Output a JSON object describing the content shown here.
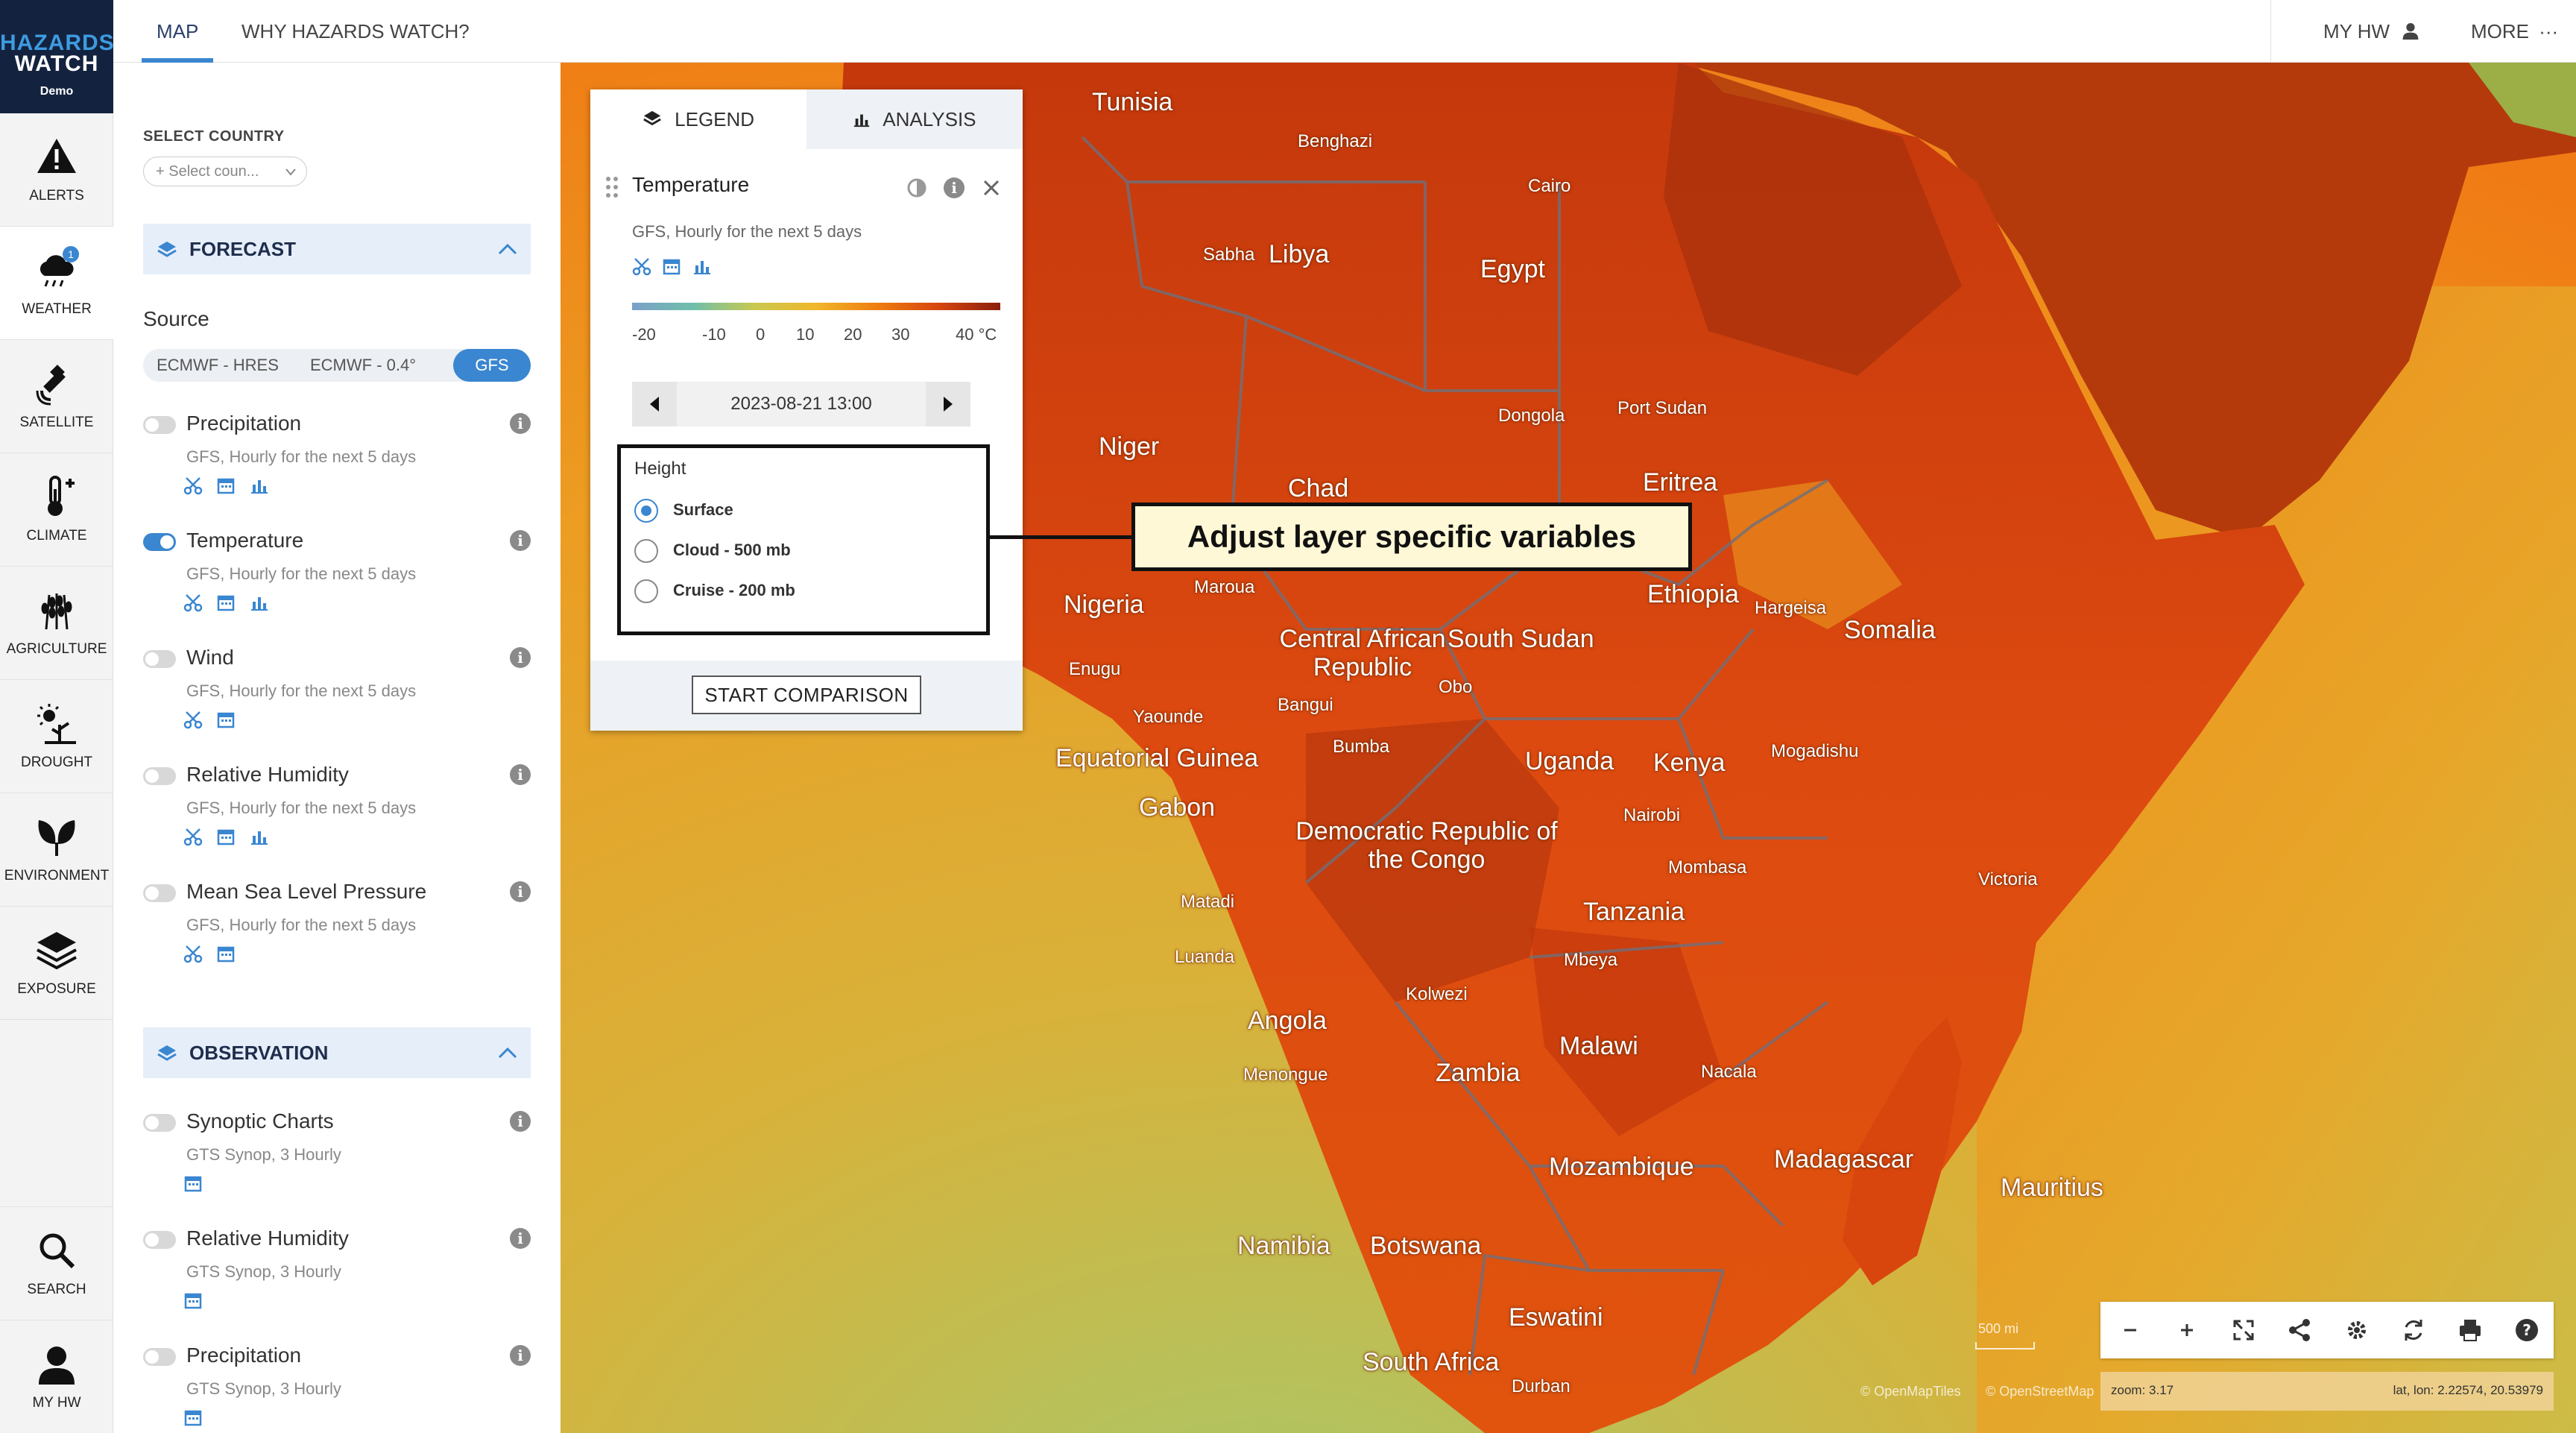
{
  "logo": {
    "line1": "HAZARDS",
    "line2": "WATCH",
    "badge": "Demo"
  },
  "rail": [
    {
      "label": "ALERTS",
      "icon": "warning-icon"
    },
    {
      "label": "WEATHER",
      "icon": "cloud-rain-icon",
      "active": true,
      "badge": "1"
    },
    {
      "label": "SATELLITE",
      "icon": "satellite-icon"
    },
    {
      "label": "CLIMATE",
      "icon": "thermometer-icon"
    },
    {
      "label": "AGRICULTURE",
      "icon": "wheat-icon"
    },
    {
      "label": "DROUGHT",
      "icon": "sun-drought-icon"
    },
    {
      "label": "ENVIRONMENT",
      "icon": "leaf-icon"
    },
    {
      "label": "EXPOSURE",
      "icon": "layers-icon"
    }
  ],
  "rail_bottom": [
    {
      "label": "SEARCH",
      "icon": "search-icon"
    },
    {
      "label": "MY HW",
      "icon": "user-icon"
    }
  ],
  "topbar": {
    "tabs": [
      "MAP",
      "WHY HAZARDS WATCH?"
    ],
    "my_hw": "MY HW",
    "more": "MORE"
  },
  "panel": {
    "select_country_label": "SELECT COUNTRY",
    "select_country_placeholder": "+ Select coun...",
    "forecast": {
      "title": "FORECAST",
      "source_label": "Source",
      "sources": [
        "ECMWF - HRES",
        "ECMWF - 0.4°",
        "GFS"
      ],
      "selected_source": "GFS",
      "layers": [
        {
          "name": "Precipitation",
          "desc": "GFS, Hourly for the next 5 days",
          "on": false,
          "tools": [
            "scissors-icon",
            "calendar-icon",
            "bar-chart-icon"
          ]
        },
        {
          "name": "Temperature",
          "desc": "GFS, Hourly for the next 5 days",
          "on": true,
          "tools": [
            "scissors-icon",
            "calendar-icon",
            "bar-chart-icon"
          ]
        },
        {
          "name": "Wind",
          "desc": "GFS, Hourly for the next 5 days",
          "on": false,
          "tools": [
            "scissors-icon",
            "calendar-icon"
          ]
        },
        {
          "name": "Relative Humidity",
          "desc": "GFS, Hourly for the next 5 days",
          "on": false,
          "tools": [
            "scissors-icon",
            "calendar-icon",
            "bar-chart-icon"
          ]
        },
        {
          "name": "Mean Sea Level Pressure",
          "desc": "GFS, Hourly for the next 5 days",
          "on": false,
          "tools": [
            "scissors-icon",
            "calendar-icon"
          ]
        }
      ]
    },
    "observation": {
      "title": "OBSERVATION",
      "layers": [
        {
          "name": "Synoptic Charts",
          "desc": "GTS Synop, 3 Hourly",
          "on": false,
          "tools": [
            "calendar-icon"
          ]
        },
        {
          "name": "Relative Humidity",
          "desc": "GTS Synop, 3 Hourly",
          "on": false,
          "tools": [
            "calendar-icon"
          ]
        },
        {
          "name": "Precipitation",
          "desc": "GTS Synop, 3 Hourly",
          "on": false,
          "tools": [
            "calendar-icon"
          ]
        }
      ]
    }
  },
  "legend": {
    "tabs": [
      "LEGEND",
      "ANALYSIS"
    ],
    "layer_title": "Temperature",
    "layer_desc": "GFS, Hourly for the next 5 days",
    "colorbar_labels": [
      "-20",
      "-10",
      "0",
      "10",
      "20",
      "30",
      "40 °C"
    ],
    "datetime": "2023-08-21 13:00",
    "height_label": "Height",
    "height_options": [
      "Surface",
      "Cloud - 500 mb",
      "Cruise - 200 mb"
    ],
    "height_selected": "Surface",
    "compare_button": "START COMPARISON"
  },
  "callout": "Adjust layer specific variables",
  "map": {
    "places": [
      {
        "name": "Tunisia",
        "kind": "country"
      },
      {
        "name": "Benghazi",
        "kind": "town"
      },
      {
        "name": "Cairo",
        "kind": "town"
      },
      {
        "name": "Sabha",
        "kind": "town"
      },
      {
        "name": "Libya",
        "kind": "country"
      },
      {
        "name": "Egypt",
        "kind": "country"
      },
      {
        "name": "Niger",
        "kind": "country"
      },
      {
        "name": "Dongola",
        "kind": "town"
      },
      {
        "name": "Port Sudan",
        "kind": "town"
      },
      {
        "name": "Chad",
        "kind": "country"
      },
      {
        "name": "Eritrea",
        "kind": "country"
      },
      {
        "name": "Nigeria",
        "kind": "country"
      },
      {
        "name": "Maroua",
        "kind": "town"
      },
      {
        "name": "Ethiopia",
        "kind": "country"
      },
      {
        "name": "Hargeisa",
        "kind": "town"
      },
      {
        "name": "Somalia",
        "kind": "country"
      },
      {
        "name": "Central African Republic",
        "kind": "country"
      },
      {
        "name": "South Sudan",
        "kind": "country"
      },
      {
        "name": "Enugu",
        "kind": "town"
      },
      {
        "name": "Obo",
        "kind": "town"
      },
      {
        "name": "Bangui",
        "kind": "town"
      },
      {
        "name": "Yaounde",
        "kind": "town"
      },
      {
        "name": "Equatorial Guinea",
        "kind": "country"
      },
      {
        "name": "Bumba",
        "kind": "town"
      },
      {
        "name": "Uganda",
        "kind": "country"
      },
      {
        "name": "Kenya",
        "kind": "country"
      },
      {
        "name": "Mogadishu",
        "kind": "town"
      },
      {
        "name": "Gabon",
        "kind": "country"
      },
      {
        "name": "Nairobi",
        "kind": "town"
      },
      {
        "name": "Democratic Republic of the Congo",
        "kind": "country"
      },
      {
        "name": "Mombasa",
        "kind": "town"
      },
      {
        "name": "Victoria",
        "kind": "town"
      },
      {
        "name": "Matadi",
        "kind": "town"
      },
      {
        "name": "Tanzania",
        "kind": "country"
      },
      {
        "name": "Luanda",
        "kind": "town"
      },
      {
        "name": "Mbeya",
        "kind": "town"
      },
      {
        "name": "Kolwezi",
        "kind": "town"
      },
      {
        "name": "Angola",
        "kind": "country"
      },
      {
        "name": "Malawi",
        "kind": "country"
      },
      {
        "name": "Menongue",
        "kind": "town"
      },
      {
        "name": "Zambia",
        "kind": "country"
      },
      {
        "name": "Nacala",
        "kind": "town"
      },
      {
        "name": "Madagascar",
        "kind": "country"
      },
      {
        "name": "Mozambique",
        "kind": "country"
      },
      {
        "name": "Mauritius",
        "kind": "country"
      },
      {
        "name": "Namibia",
        "kind": "country"
      },
      {
        "name": "Botswana",
        "kind": "country"
      },
      {
        "name": "Eswatini",
        "kind": "country"
      },
      {
        "name": "South Africa",
        "kind": "country"
      },
      {
        "name": "Durban",
        "kind": "town"
      }
    ],
    "scale": "500 mi",
    "attribution": [
      "© OpenMapTiles",
      "© OpenStreetMap contributors"
    ],
    "zoom_text": "zoom: 3.17",
    "latlon_text": "lat, lon: 2.22574, 20.53979",
    "tools": [
      "zoom-out-icon",
      "zoom-in-icon",
      "fullscreen-icon",
      "share-icon",
      "settings-icon",
      "refresh-icon",
      "print-icon",
      "help-icon"
    ]
  },
  "colors": {
    "accent": "#3a86d0",
    "navy": "#13233f",
    "callout_bg": "#fff8d6"
  }
}
